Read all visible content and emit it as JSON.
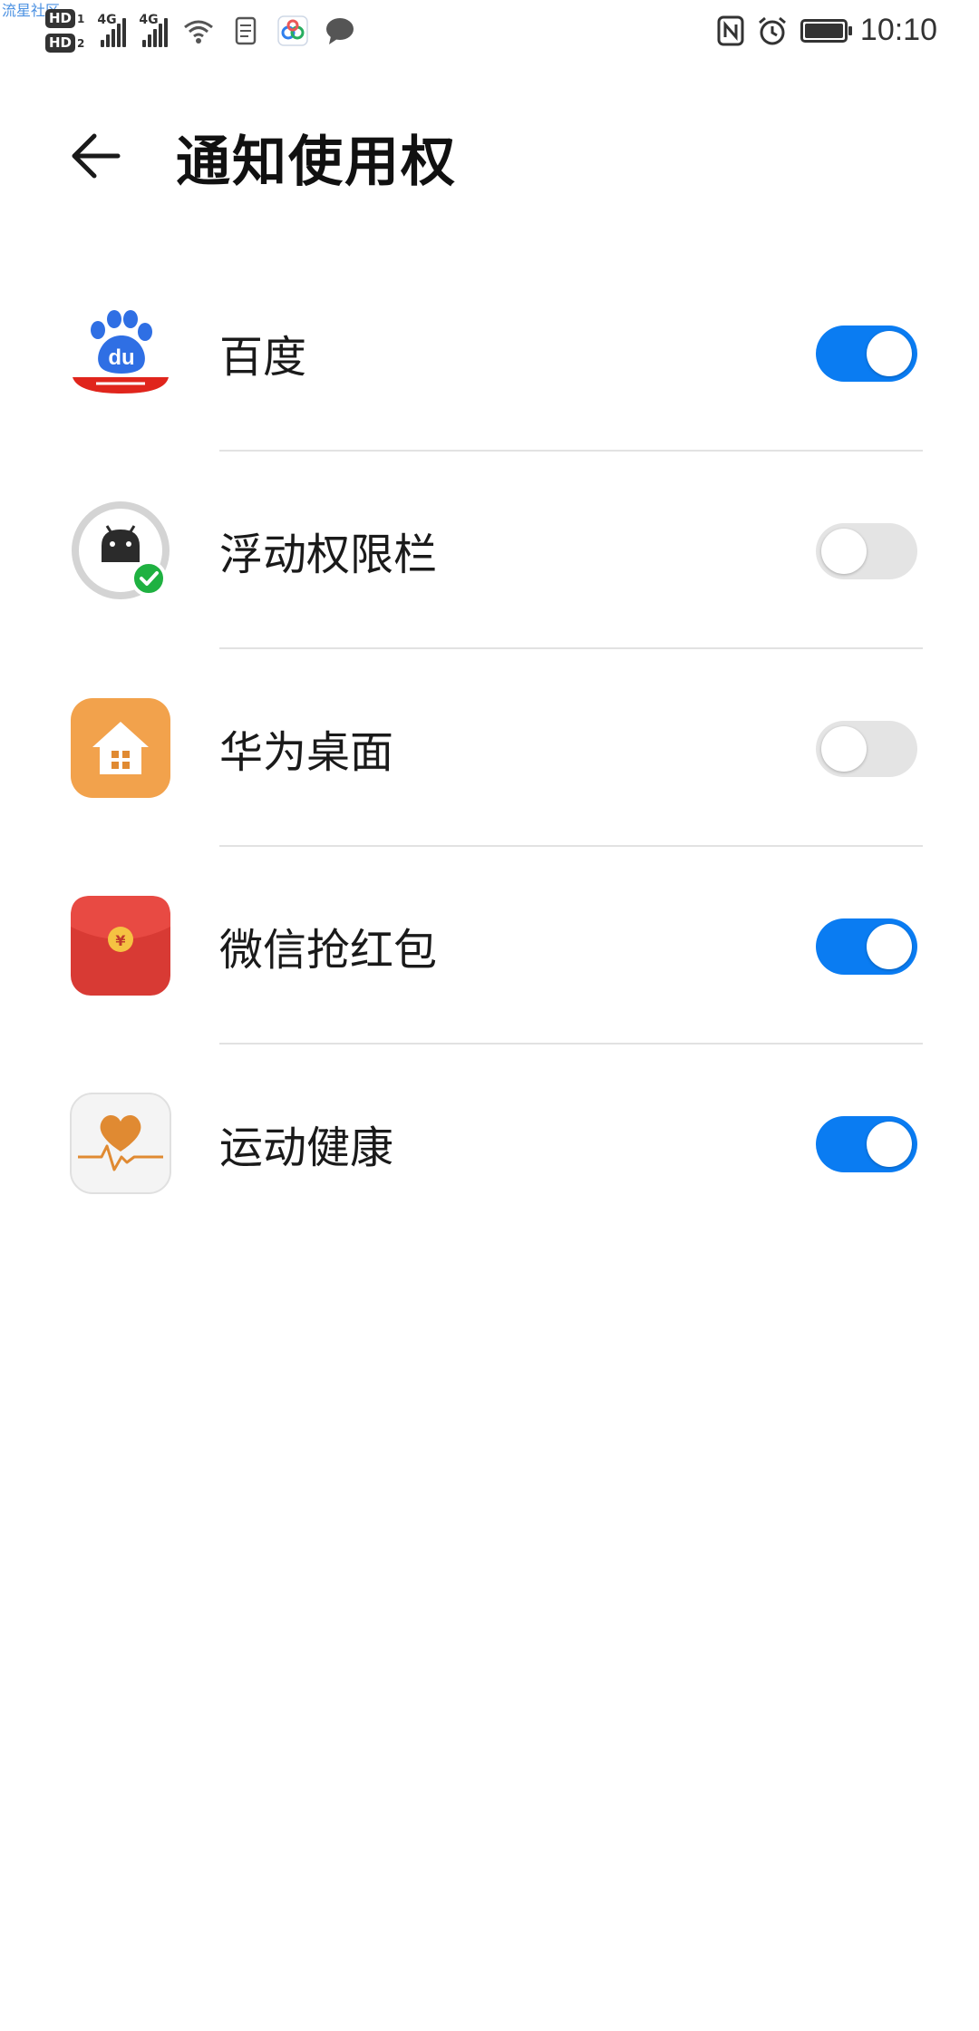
{
  "status_bar": {
    "watermark": "流星社区",
    "sim1_label": "HD",
    "sim1_num": "1",
    "sim2_label": "HD",
    "sim2_num": "2",
    "network1": "4G",
    "network2": "4G",
    "time": "10:10",
    "icons": [
      "wifi-icon",
      "document-icon",
      "app-icon",
      "chat-bubble-icon",
      "nfc-icon",
      "alarm-icon",
      "battery-icon"
    ]
  },
  "header": {
    "title": "通知使用权",
    "back_icon": "arrow-left-icon"
  },
  "apps": [
    {
      "name": "百度",
      "icon": "baidu-icon",
      "enabled": true
    },
    {
      "name": "浮动权限栏",
      "icon": "android-permission-icon",
      "enabled": false
    },
    {
      "name": "华为桌面",
      "icon": "huawei-home-icon",
      "enabled": false
    },
    {
      "name": "微信抢红包",
      "icon": "red-envelope-icon",
      "enabled": true
    },
    {
      "name": "运动健康",
      "icon": "health-heart-icon",
      "enabled": true
    }
  ],
  "colors": {
    "toggle_on": "#0a7cf2",
    "toggle_off": "#e4e4e4",
    "divider": "#e2e2e2"
  }
}
